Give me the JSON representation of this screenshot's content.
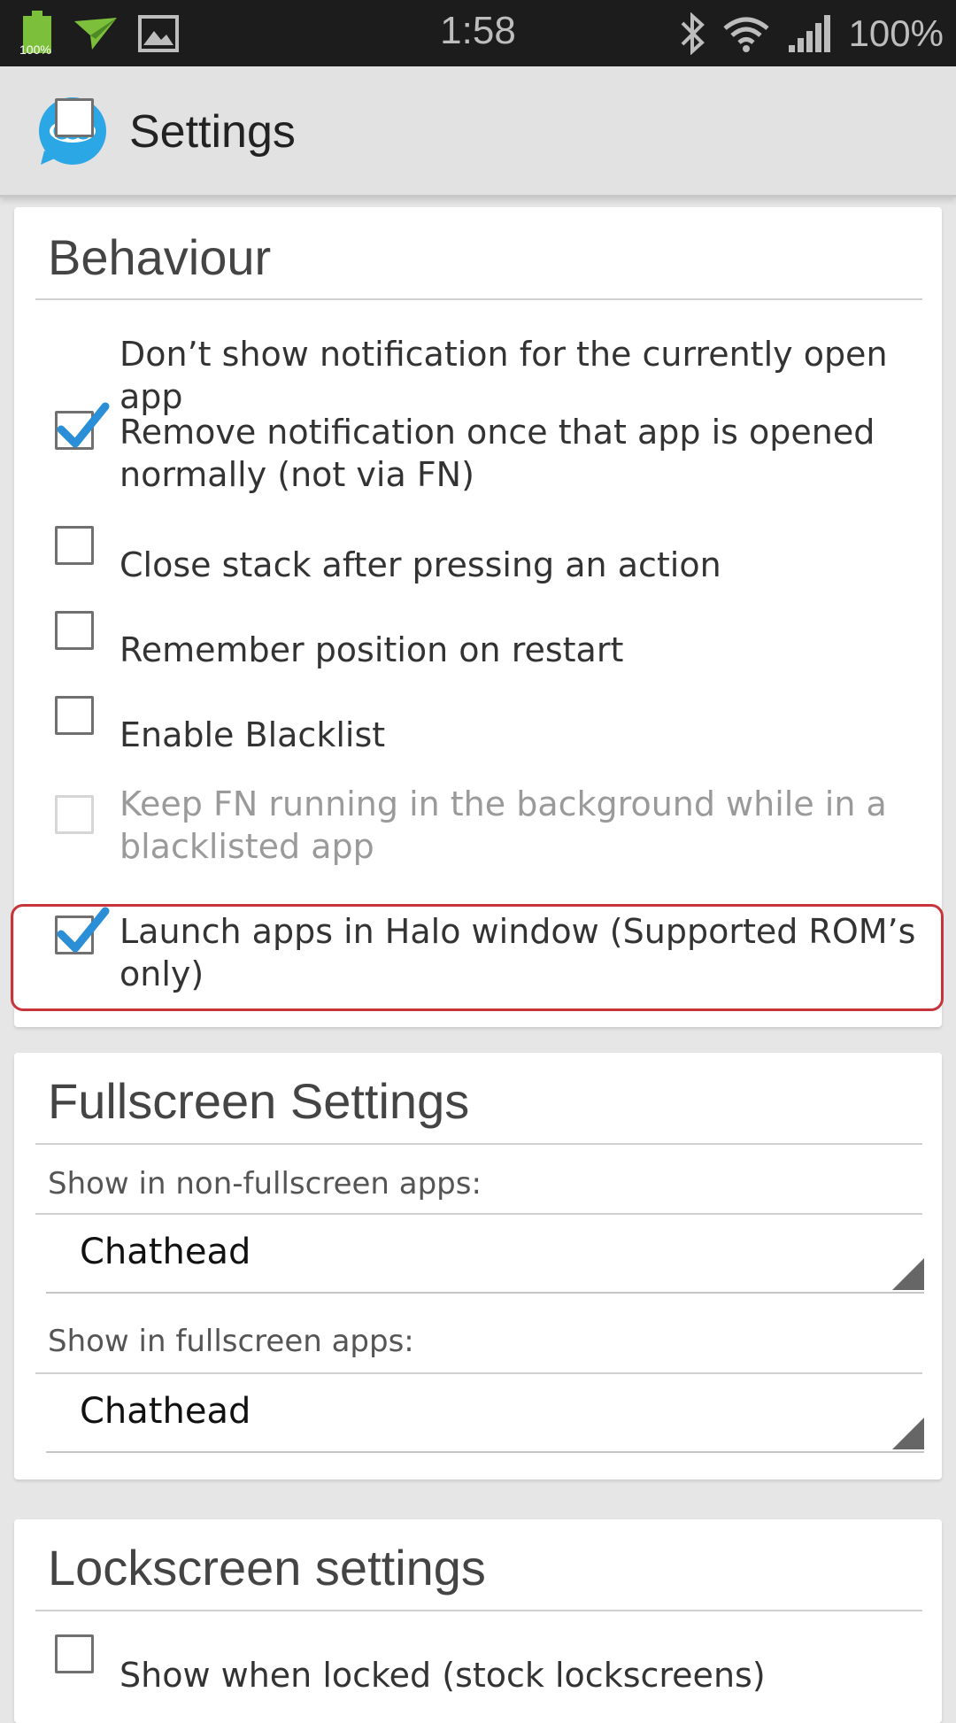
{
  "status_bar": {
    "battery_badge": "100%",
    "time": "1:58",
    "battery_percent": "100%",
    "left_icons": [
      "battery-icon",
      "paper-plane-icon",
      "image-icon"
    ],
    "right_icons": [
      "bluetooth-icon",
      "wifi-icon",
      "signal-icon"
    ]
  },
  "action_bar": {
    "title": "Settings",
    "logo": "chat-bubble-logo-icon"
  },
  "colors": {
    "accent_check": "#2a8fd6",
    "highlight_border": "#c8343c",
    "logo_blue": "#2aa7e4"
  },
  "behaviour": {
    "title": "Behaviour",
    "items": [
      {
        "label": "Don’t show notification for the currently open app",
        "checked": false,
        "enabled": true
      },
      {
        "label": "Remove notification once that app is opened normally (not via FN)",
        "checked": true,
        "enabled": true
      },
      {
        "label": "Close stack after pressing an action",
        "checked": false,
        "enabled": true
      },
      {
        "label": "Remember position on restart",
        "checked": false,
        "enabled": true
      },
      {
        "label": "Enable Blacklist",
        "checked": false,
        "enabled": true
      },
      {
        "label": "Keep FN running in the background while in a blacklisted app",
        "checked": false,
        "enabled": false
      },
      {
        "label": "Launch apps in Halo window (Supported ROM’s only)",
        "checked": true,
        "enabled": true,
        "highlighted": true
      }
    ]
  },
  "fullscreen": {
    "title": "Fullscreen Settings",
    "non_fullscreen_label": "Show in non-fullscreen apps:",
    "non_fullscreen_value": "Chathead",
    "fullscreen_label": "Show in fullscreen apps:",
    "fullscreen_value": "Chathead"
  },
  "lockscreen": {
    "title": "Lockscreen settings",
    "items": [
      {
        "label": "Show when locked (stock lockscreens)",
        "checked": false,
        "enabled": true
      }
    ]
  }
}
